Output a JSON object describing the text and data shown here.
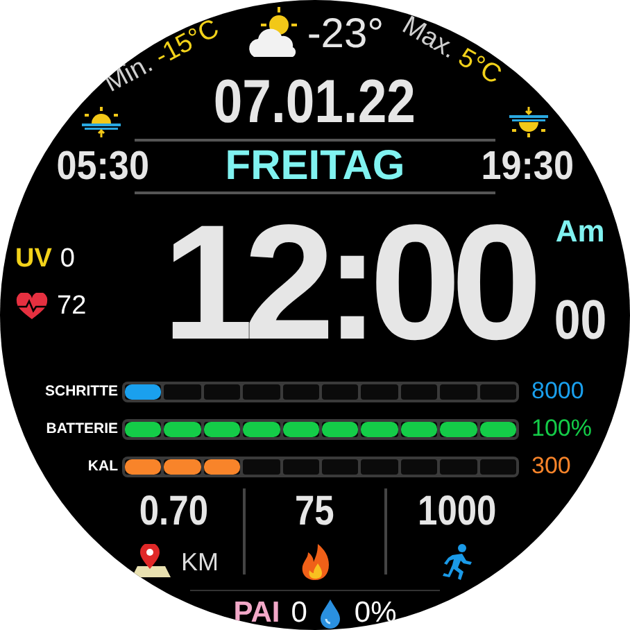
{
  "weather": {
    "min": {
      "label": "Min.",
      "value": "-15°C"
    },
    "temperature": "-23°",
    "max": {
      "label": "Max.",
      "value": "5°C"
    }
  },
  "date": "07.01.22",
  "sunrise": "05:30",
  "weekday": "FREITAG",
  "sunset": "19:30",
  "uv": {
    "label": "UV",
    "value": "0"
  },
  "heart_rate": "72",
  "time": "12:00",
  "meridiem": "Am",
  "seconds": "00",
  "bars": [
    {
      "label": "SCHRITTE",
      "level": 0.1,
      "value": "8000",
      "color": "#1aa0ee"
    },
    {
      "label": "BATTERIE",
      "level": 1.0,
      "value": "100%",
      "color": "#14cc48"
    },
    {
      "label": "KAL",
      "level": 0.3,
      "value": "300",
      "color": "#f8842a"
    }
  ],
  "stats": [
    {
      "kind": "distance",
      "value": "0.70",
      "unit": "KM"
    },
    {
      "kind": "calories",
      "value": "75"
    },
    {
      "kind": "steps",
      "value": "1000"
    }
  ],
  "pai": {
    "label": "PAI",
    "value": "0"
  },
  "humidity": "0%"
}
